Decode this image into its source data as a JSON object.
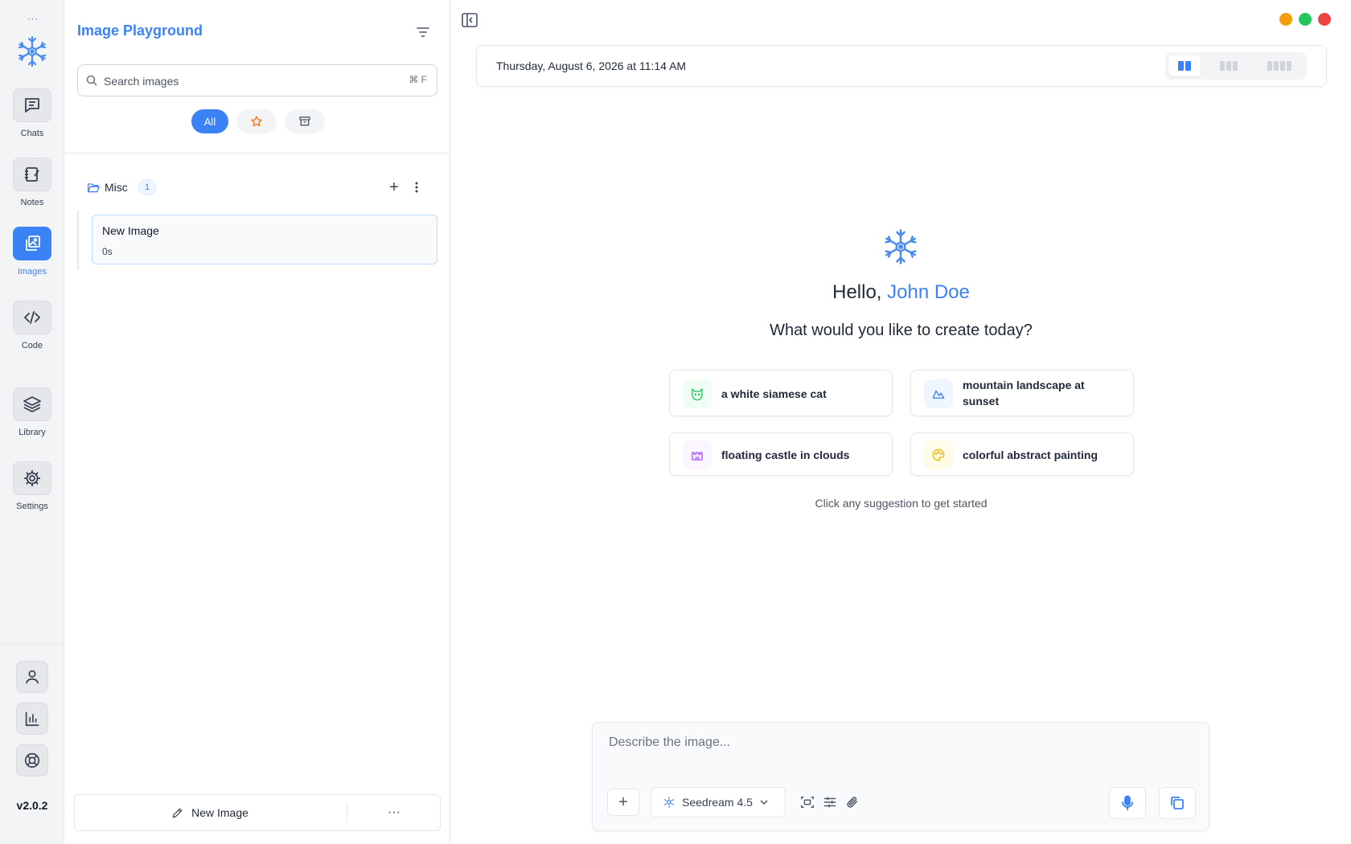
{
  "rail": {
    "items": [
      {
        "label": "Chats",
        "icon": "chat-icon"
      },
      {
        "label": "Notes",
        "icon": "notes-icon"
      },
      {
        "label": "Images",
        "icon": "images-icon",
        "active": true
      },
      {
        "label": "Code",
        "icon": "code-icon"
      },
      {
        "label": "Library",
        "icon": "layers-icon"
      },
      {
        "label": "Settings",
        "icon": "gear-icon"
      }
    ],
    "bottom_icons": [
      "user-icon",
      "chart-icon",
      "help-icon"
    ],
    "version": "v2.0.2"
  },
  "sidebar": {
    "title": "Image Playground",
    "search": {
      "placeholder": "Search images",
      "shortcut": "⌘ F"
    },
    "filters": {
      "all_label": "All",
      "favorites_icon": "star-icon",
      "archive_icon": "archive-icon"
    },
    "folder": {
      "name": "Misc",
      "count": "1"
    },
    "items": [
      {
        "title": "New Image",
        "meta": "0s"
      }
    ],
    "new_button_label": "New Image",
    "more_label": "···"
  },
  "main": {
    "date": "Thursday, August 6, 2026 at 11:14 AM",
    "greeting": {
      "hello": "Hello,",
      "name": "John Doe"
    },
    "subtitle": "What would you like to create today?",
    "suggestions": [
      {
        "text": "a white siamese cat",
        "icon": "cat-icon",
        "color": "#22c55e"
      },
      {
        "text": "mountain landscape at sunset",
        "icon": "mountain-icon",
        "color": "#3b82f6"
      },
      {
        "text": "floating castle in clouds",
        "icon": "castle-icon",
        "color": "#a855f7"
      },
      {
        "text": "colorful abstract painting",
        "icon": "palette-icon",
        "color": "#eab308"
      }
    ],
    "hint": "Click any suggestion to get started",
    "composer": {
      "placeholder": "Describe the image...",
      "model": "Seedream 4.5"
    }
  },
  "window_controls": {
    "colors": [
      "#f59e0b",
      "#22c55e",
      "#ef4444"
    ]
  },
  "colors": {
    "accent": "#3b82f6"
  }
}
